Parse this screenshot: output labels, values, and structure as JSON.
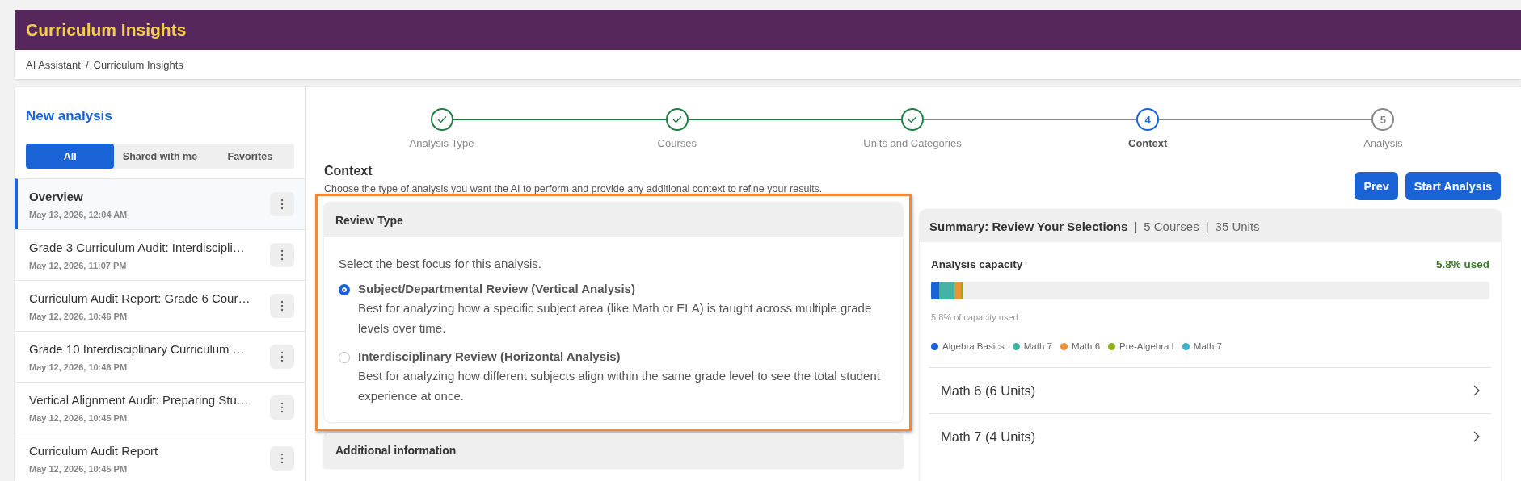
{
  "header": {
    "title": "Curriculum Insights"
  },
  "breadcrumb": [
    {
      "text": "AI Assistant",
      "separator": "/"
    },
    {
      "text": "Curriculum Insights"
    }
  ],
  "sidebar": {
    "title": "New analysis",
    "filters": [
      {
        "label": "All",
        "selected": true
      },
      {
        "label": "Shared with me",
        "selected": false
      },
      {
        "label": "Favorites",
        "selected": false
      }
    ],
    "items": [
      {
        "title": "Overview",
        "date": "May 13, 2026, 12:04 AM",
        "selected": true
      },
      {
        "title": "Grade 3 Curriculum Audit: Interdiscipli…",
        "date": "May 12, 2026, 11:07 PM",
        "selected": false
      },
      {
        "title": "Curriculum Audit Report: Grade 6 Cour…",
        "date": "May 12, 2026, 10:46 PM",
        "selected": false
      },
      {
        "title": "Grade 10 Interdisciplinary Curriculum …",
        "date": "May 12, 2026, 10:46 PM",
        "selected": false
      },
      {
        "title": "Vertical Alignment Audit: Preparing Stu…",
        "date": "May 12, 2026, 10:45 PM",
        "selected": false
      },
      {
        "title": "Curriculum Audit Report",
        "date": "May 12, 2026, 10:45 PM",
        "selected": false
      }
    ]
  },
  "stepper": [
    {
      "label": "Analysis Type",
      "done": true,
      "current": false
    },
    {
      "label": "Courses",
      "done": true,
      "current": false
    },
    {
      "label": "Units and Categories",
      "done": true,
      "current": false
    },
    {
      "label": "Context",
      "done": false,
      "current": true,
      "number": "4"
    },
    {
      "label": "Analysis",
      "done": false,
      "current": false,
      "number": "5"
    }
  ],
  "context": {
    "title": "Context",
    "subtitle": "Choose the type of analysis you want the AI to perform and provide any additional context to refine your results.",
    "buttons": [
      "Prev",
      "Start Analysis"
    ]
  },
  "review_type": {
    "title": "Review Type",
    "prompt": "Select the best focus for this analysis.",
    "options": [
      {
        "title": "Subject/Departmental Review (Vertical Analysis)",
        "description": "Best for analyzing how a specific subject area (like Math or ELA) is taught across multiple grade levels over time.",
        "selected": true
      },
      {
        "title": "Interdisciplinary Review (Horizontal Analysis)",
        "description": "Best for analyzing how different subjects align within the same grade level to see the total student experience at once.",
        "selected": false
      }
    ]
  },
  "additional_information": {
    "title": "Additional information"
  },
  "summary": {
    "title": "Summary: Review Your Selections",
    "stats": [
      {
        "separator": "|",
        "text": "5 Courses"
      },
      {
        "separator": "|",
        "text": "35 Units"
      }
    ],
    "capacity": {
      "label": "Analysis capacity",
      "used": "5.8% used",
      "caption": "5.8% of capacity used",
      "segments": [
        {
          "color": "#1a63d6",
          "level": 0.014
        },
        {
          "color": "#44b3a6",
          "level": 0.028
        },
        {
          "color": "#e8923a",
          "level": 0.012
        },
        {
          "color": "#8fae1b",
          "level": 0.002
        },
        {
          "color": "#3bb0cc",
          "level": 0.002
        }
      ],
      "legend": [
        {
          "name": "Algebra Basics",
          "color": "#1a63d6"
        },
        {
          "name": "Math 7",
          "color": "#44b3a6"
        },
        {
          "name": "Math 6",
          "color": "#e8923a"
        },
        {
          "name": "Pre-Algebra I",
          "color": "#8fae1b"
        },
        {
          "name": "Math 7",
          "color": "#3bb0cc"
        }
      ]
    },
    "groups": [
      {
        "label": "Math 6 (6 Units)"
      },
      {
        "label": "Math 7 (4 Units)"
      }
    ]
  }
}
